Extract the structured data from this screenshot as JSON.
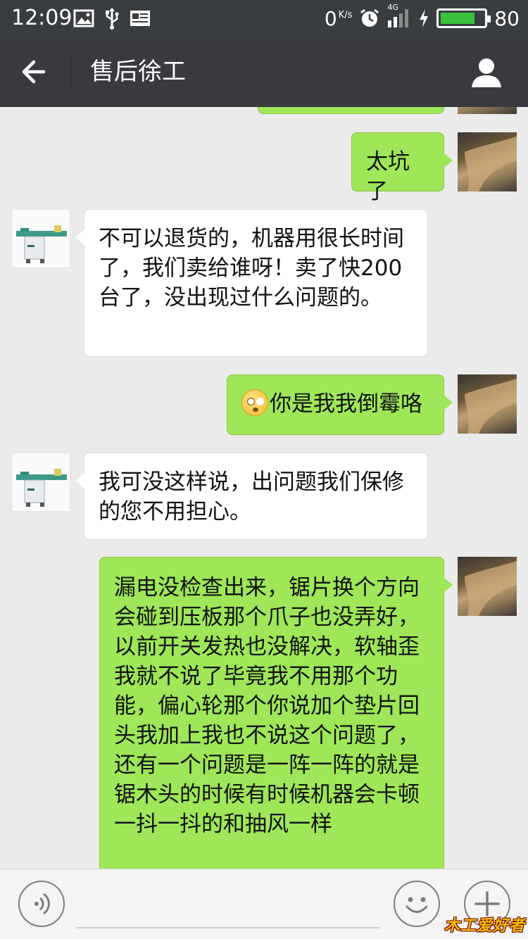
{
  "status_bar": {
    "time": "12:09",
    "net_speed_value": "0",
    "net_speed_unit": "K/s",
    "signal_label": "4G",
    "battery_level": "80",
    "battery_fraction": 0.8,
    "icons": [
      "image-icon",
      "usb-icon",
      "news-icon",
      "alarm-icon",
      "signal-icon",
      "charging-icon",
      "battery-icon"
    ]
  },
  "header": {
    "title": "售后徐工",
    "back_icon": "arrow-left-icon",
    "profile_icon": "person-icon"
  },
  "messages": [
    {
      "sender": "me",
      "text": "太坑了"
    },
    {
      "sender": "other",
      "text": "不可以退货的，机器用很长时间了，我们卖给谁呀！卖了快200台了，没出现过什么问题的。"
    },
    {
      "sender": "me",
      "emoji": "dizzy-face-emoji",
      "text": "你是我我倒霉咯"
    },
    {
      "sender": "other",
      "text": "我可没这样说，出问题我们保修的您不用担心。"
    },
    {
      "sender": "me",
      "text": "漏电没检查出来，锯片换个方向会碰到压板那个爪子也没弄好，以前开关发热也没解决，软轴歪我就不说了毕竟我不用那个功能，偏心轮那个你说加个垫片回头我加上我也不说这个问题了，还有一个问题是一阵一阵的就是锯木头的时候有时候机器会卡顿一抖一抖的和抽风一样"
    }
  ],
  "bottom_bar": {
    "voice_icon": "voice-icon",
    "emoji_icon": "smiley-icon",
    "more_icon": "plus-icon"
  },
  "watermark": "木工爱好者",
  "colors": {
    "header_bg": "#393a3f",
    "chat_bg": "#ebebeb",
    "my_bubble": "#9fe658",
    "other_bubble": "#ffffff",
    "battery": "#39c23c"
  }
}
